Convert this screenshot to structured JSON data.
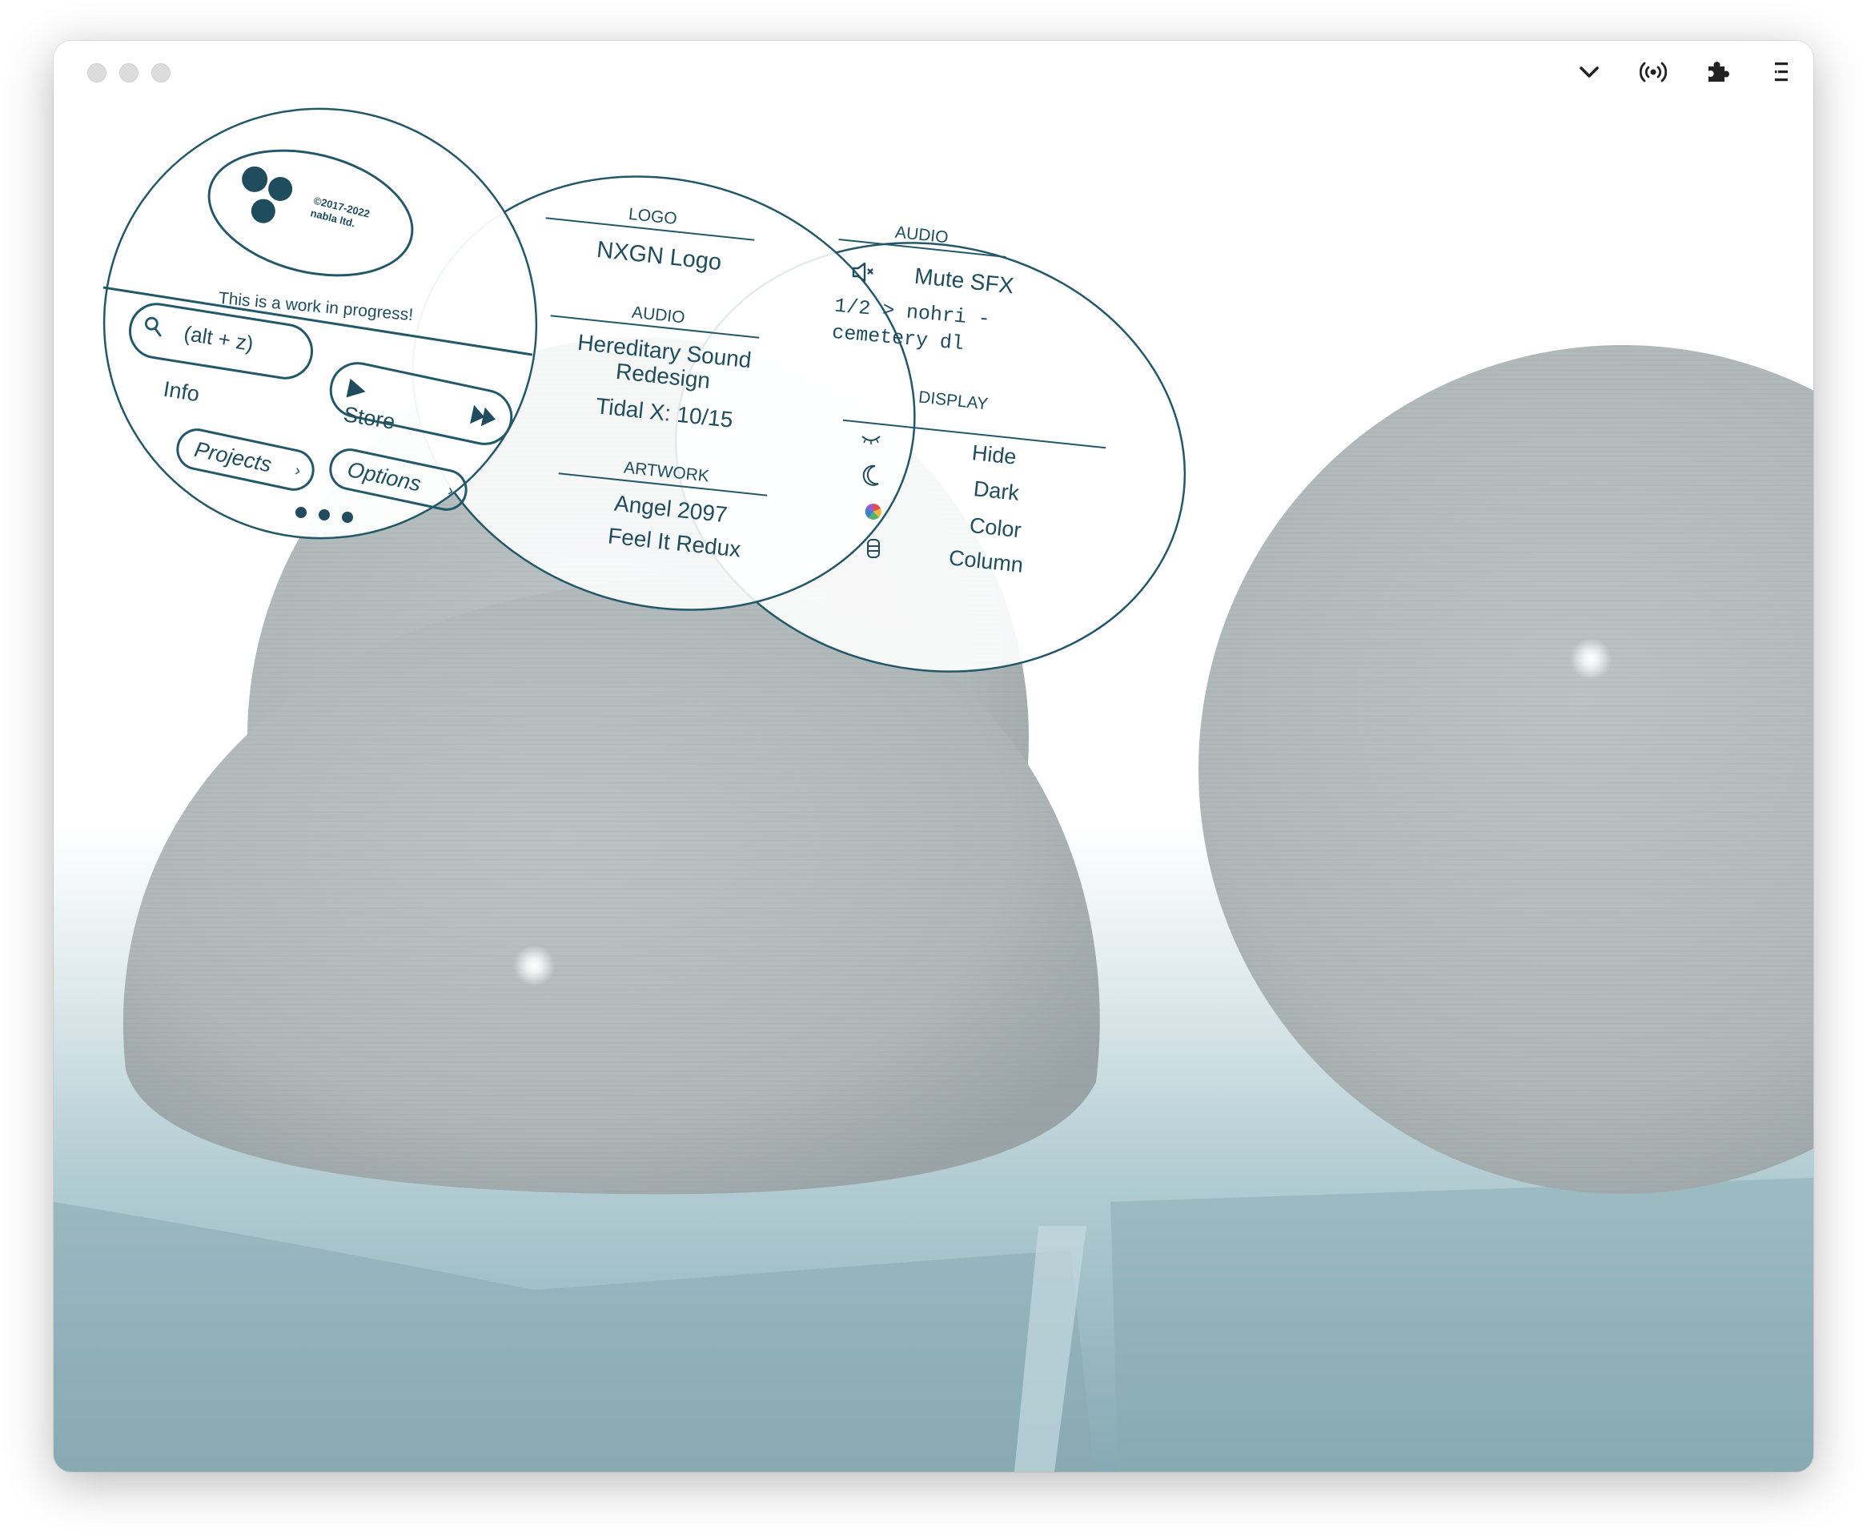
{
  "window": {
    "toolbar_icons": [
      "chevron-down-icon",
      "broadcast-icon",
      "puzzle-icon",
      "menu-icon"
    ]
  },
  "main_disc": {
    "copyright": "©2017-2022",
    "company": "nabla ltd.",
    "tagline": "This is a work in progress!",
    "search_shortcut": "(alt + z)",
    "info": "Info",
    "store": "Store",
    "projects": "Projects",
    "options": "Options"
  },
  "projects_disc": {
    "logo_heading": "LOGO",
    "logo_item": "NXGN Logo",
    "audio_heading": "AUDIO",
    "audio_item_1_line1": "Hereditary Sound",
    "audio_item_1_line2": "Redesign",
    "audio_item_2": "Tidal X: 10/15",
    "artwork_heading": "ARTWORK",
    "artwork_item_1": "Angel 2097",
    "artwork_item_2": "Feel It Redux"
  },
  "options_disc": {
    "audio_heading": "AUDIO",
    "mute": "Mute SFX",
    "track_line1": "1/2 > nohri -",
    "track_line2": "cemetery dl",
    "display_heading": "DISPLAY",
    "hide": "Hide",
    "dark": "Dark",
    "color": "Color",
    "column": "Column"
  },
  "colors": {
    "ink": "#1f4d5e",
    "sphere": "#b3bbbc",
    "water": "#8fb3bd"
  }
}
